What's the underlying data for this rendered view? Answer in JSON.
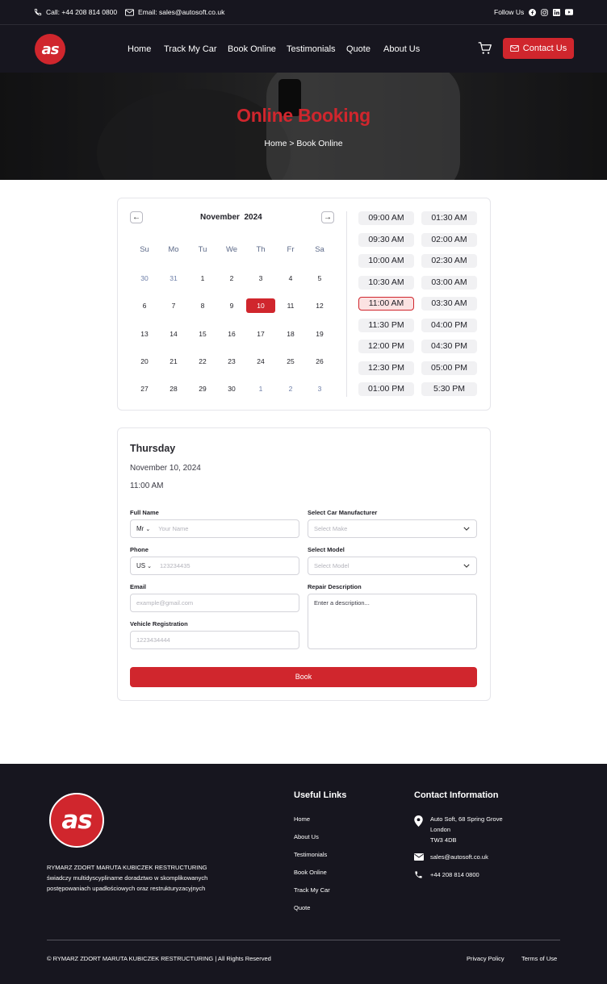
{
  "topbar": {
    "phone": "Call: +44 208 814 0800",
    "email": "Email: sales@autosoft.co.uk",
    "follow": "Follow Us",
    "social_icons": [
      "facebook-icon",
      "instagram-icon",
      "linkedin-icon",
      "youtube-icon"
    ]
  },
  "logo": {
    "text": "as"
  },
  "nav": {
    "items": [
      "Home",
      "Track My Car",
      "Book Online",
      "Testimonials",
      "Quote",
      "About Us"
    ],
    "contact_label": "Contact Us"
  },
  "hero": {
    "title": "Online Booking",
    "breadcrumb": "Home > Book Online"
  },
  "calendar": {
    "month": "November  2024",
    "weekdays": [
      "Su",
      "Mo",
      "Tu",
      "We",
      "Th",
      "Fr",
      "Sa"
    ],
    "days": [
      [
        "30",
        "31",
        "1",
        "2",
        "3",
        "4",
        "5"
      ],
      [
        "6",
        "7",
        "8",
        "9",
        "10",
        "11",
        "12"
      ],
      [
        "13",
        "14",
        "15",
        "16",
        "17",
        "18",
        "19"
      ],
      [
        "20",
        "21",
        "22",
        "23",
        "24",
        "25",
        "26"
      ],
      [
        "27",
        "28",
        "29",
        "30",
        "1",
        "2",
        "3"
      ]
    ],
    "muted_days": [
      [
        0,
        0
      ],
      [
        0,
        1
      ],
      [
        4,
        4
      ],
      [
        4,
        5
      ],
      [
        4,
        6
      ]
    ],
    "selected_day": [
      1,
      4
    ]
  },
  "timeslots": {
    "left": [
      "09:00 AM",
      "09:30 AM",
      "10:00 AM",
      "10:30 AM",
      "11:00 AM",
      "11:30 PM",
      "12:00 PM",
      "12:30 PM",
      "01:00 PM"
    ],
    "right": [
      "01:30 AM",
      "02:00 AM",
      "02:30 AM",
      "03:00 AM",
      "03:30 AM",
      "04:00 PM",
      "04:30 PM",
      "05:00 PM",
      "5:30 PM"
    ],
    "selected": "11:00 AM"
  },
  "summary": {
    "day": "Thursday",
    "date": "November 10, 2024",
    "time": "11:00 AM"
  },
  "form": {
    "full_name_label": "Full Name",
    "title_value": "Mr",
    "name_placeholder": "Your Name",
    "phone_label": "Phone",
    "country_value": "US",
    "phone_placeholder": "123234435",
    "email_label": "Email",
    "email_placeholder": "example@gmail.com",
    "vehicle_label": "Vehicle Registration",
    "vehicle_placeholder": "1223434444",
    "manufacturer_label": "Select Car Manufacturer",
    "manufacturer_placeholder": "Select Make",
    "model_label": "Select Model",
    "model_placeholder": "Select Model",
    "repair_label": "Repair Description",
    "repair_placeholder": "Enter a description...",
    "book_label": "Book"
  },
  "footer": {
    "company": "RYMARZ ZDORT MARUTA KUBICZEK RESTRUCTURING",
    "tagline_1": "świadczy multidyscyplinarne  doradztwo w skomplikowanych",
    "tagline_2": "postępowaniach upadłościowych oraz restrukturyzacyjnych",
    "useful_links_title": "Useful Links",
    "useful_links": [
      "Home",
      "About Us",
      "Testimonials",
      "Book Online",
      "Track My Car",
      "Quote"
    ],
    "contact_title": "Contact Information",
    "address_1": "Auto Soft, 68 Spring Grove",
    "address_2": "London",
    "address_3": "TW3 4DB",
    "email": "sales@autosoft.co.uk",
    "phone": "+44 208 814 0800",
    "copyright": "© RYMARZ ZDORT MARUTA KUBICZEK RESTRUCTURING | All Rights Reserved",
    "privacy": "Privacy Policy",
    "terms": "Terms of Use"
  },
  "colors": {
    "accent": "#d0262d",
    "dark": "#17161f",
    "muted_day": "#6d7ea8"
  }
}
